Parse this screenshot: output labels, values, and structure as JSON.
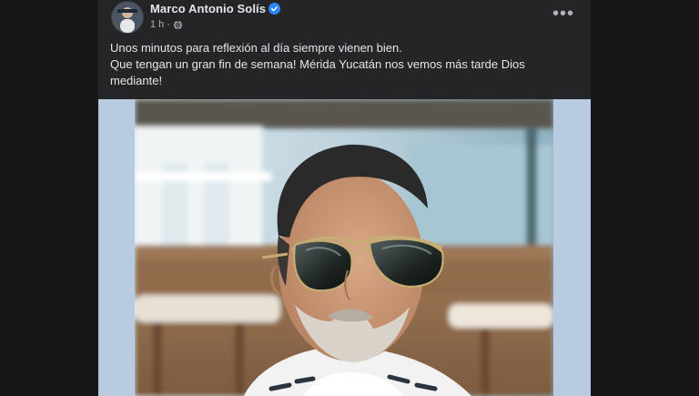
{
  "post": {
    "author": "Marco Antonio Solís",
    "verified": true,
    "time": "1 h",
    "separator": "·",
    "audience_icon": "globe-icon",
    "more_label": "•••",
    "lines": [
      "Unos minutos para reflexión al día siempre vienen bien.",
      "Que tengan un gran fin de semana! Mérida Yucatán nos vemos  más tarde Dios mediante!"
    ],
    "photo": {
      "subject": "selfie-photo",
      "colors": {
        "frame": "#b9cbe0",
        "hair": "#2a2a2a",
        "skin": "#c79778",
        "glasses": "#1f2224"
      }
    }
  }
}
